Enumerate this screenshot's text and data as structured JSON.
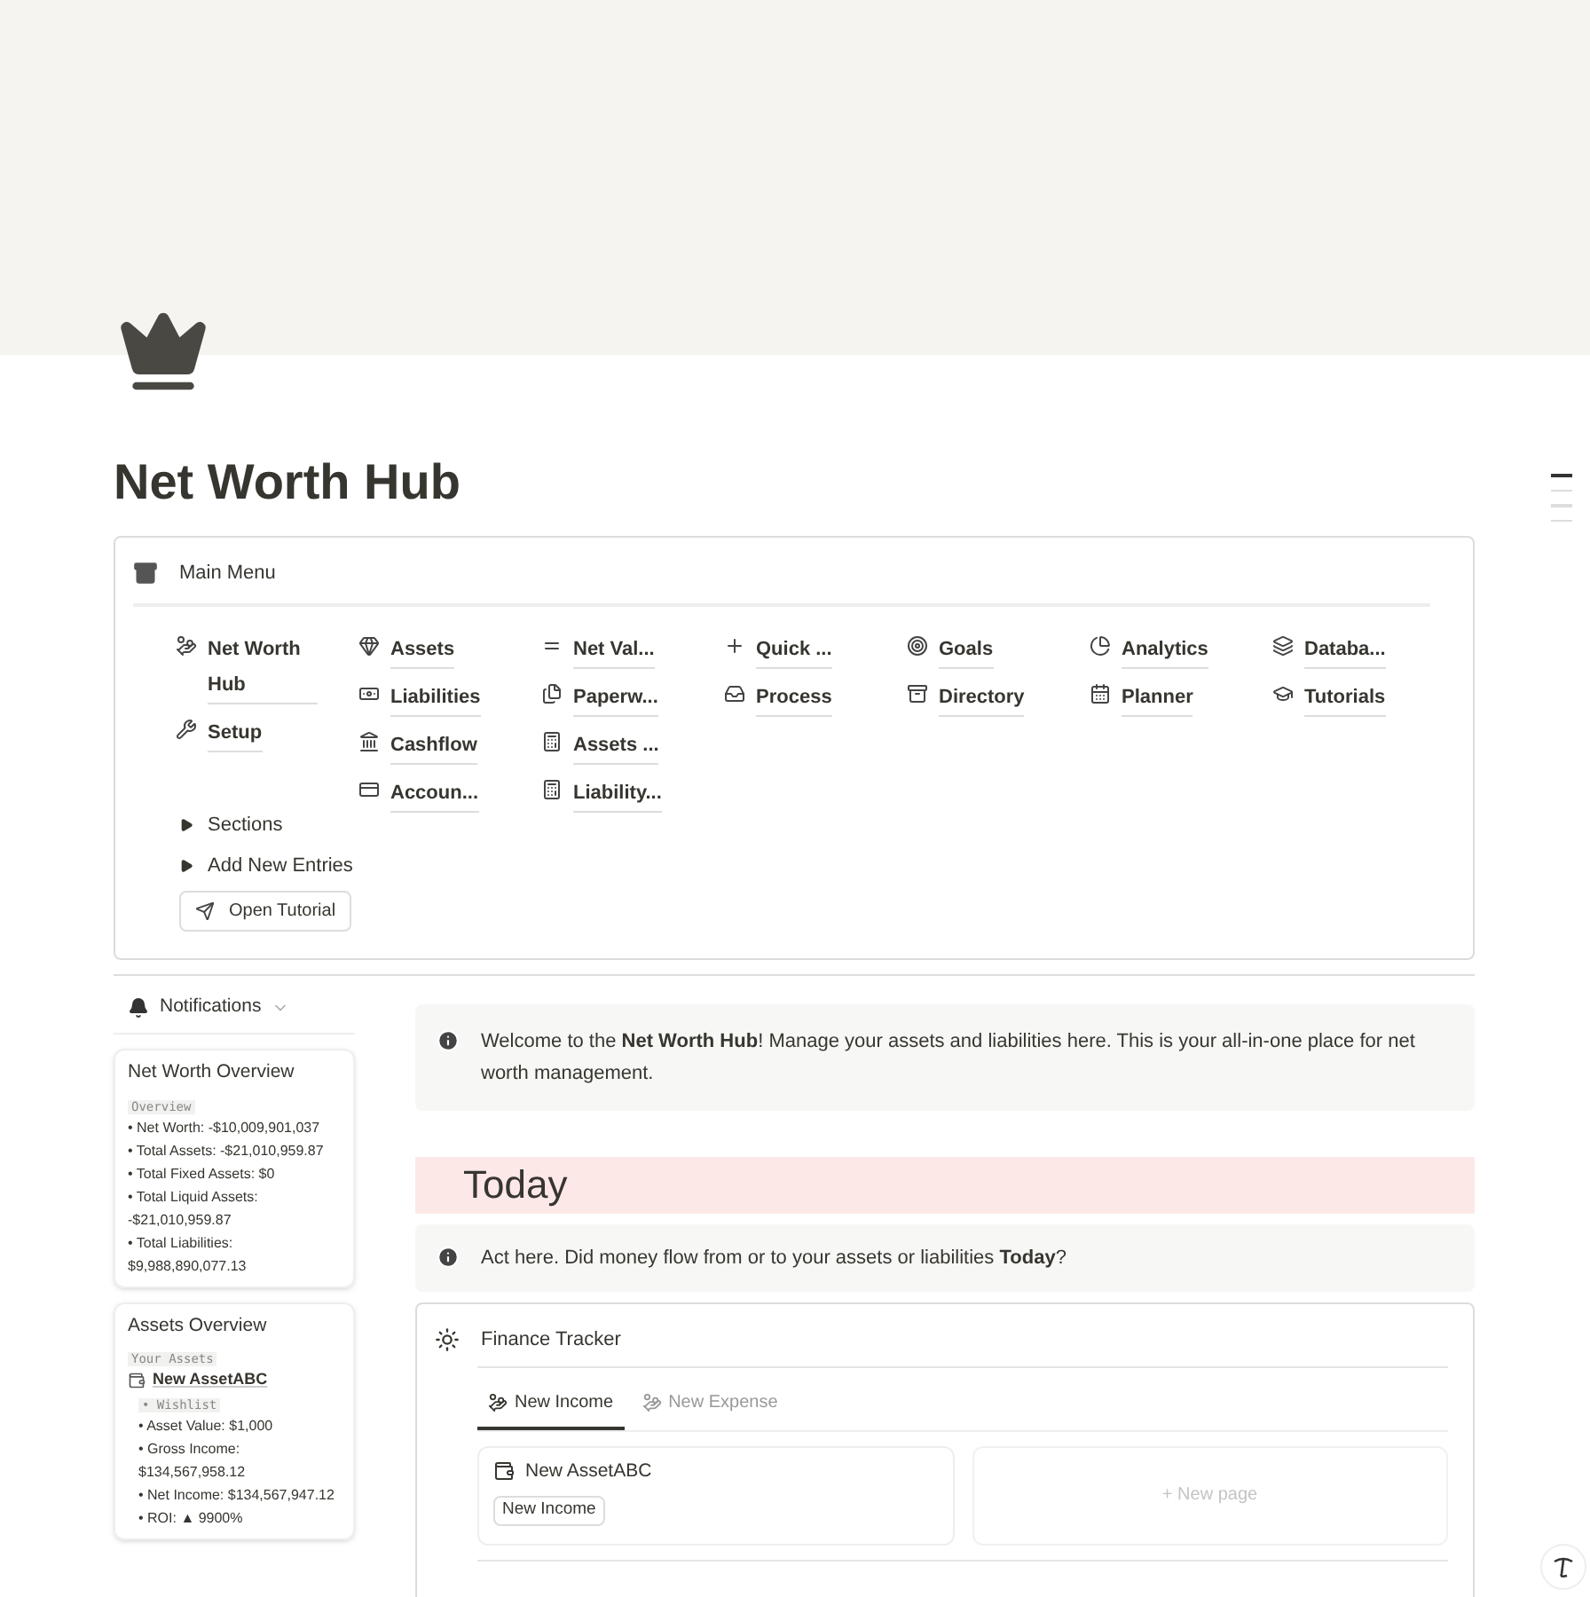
{
  "page": {
    "title": "Net Worth Hub"
  },
  "main_menu": {
    "title": "Main Menu",
    "columns": [
      {
        "items": [
          {
            "label": "Net Worth Hub"
          },
          {
            "label": "Setup"
          }
        ]
      },
      {
        "items": [
          {
            "label": "Assets"
          },
          {
            "label": "Liabilities"
          },
          {
            "label": "Cashflow"
          },
          {
            "label": "Accoun..."
          }
        ]
      },
      {
        "items": [
          {
            "label": "Net Val..."
          },
          {
            "label": "Paperw..."
          },
          {
            "label": "Assets ..."
          },
          {
            "label": "Liability..."
          }
        ]
      },
      {
        "items": [
          {
            "label": "Quick ..."
          },
          {
            "label": "Process"
          }
        ]
      },
      {
        "items": [
          {
            "label": "Goals"
          },
          {
            "label": "Directory"
          }
        ]
      },
      {
        "items": [
          {
            "label": "Analytics"
          },
          {
            "label": "Planner"
          }
        ]
      },
      {
        "items": [
          {
            "label": "Databa..."
          },
          {
            "label": "Tutorials"
          }
        ]
      }
    ],
    "toggles": [
      {
        "label": "Sections",
        "expanded": false
      },
      {
        "label": "Add New Entries",
        "expanded": false
      }
    ],
    "button": "Open Tutorial"
  },
  "sidebar": {
    "notifications": "Notifications",
    "cards": [
      {
        "title": "Net Worth Overview",
        "lines": [
          {
            "kind": "code",
            "text": "Overview"
          },
          {
            "kind": "bullet",
            "text": "• Net Worth: -$10,009,901,037"
          },
          {
            "kind": "bullet",
            "text": "• Total Assets: -$21,010,959.87"
          },
          {
            "kind": "bullet",
            "text": "• Total Fixed Assets: $0"
          },
          {
            "kind": "bullet",
            "text": "• Total Liquid Assets: -$21,010,959.87"
          },
          {
            "kind": "bullet",
            "text": "• Total Liabilities: $9,988,890,077.13"
          }
        ]
      },
      {
        "title": "Assets Overview",
        "lines": [
          {
            "kind": "code",
            "text": "Your Assets"
          },
          {
            "kind": "link",
            "text": "New AssetABC"
          },
          {
            "kind": "code_sub",
            "text": "• Wishlist"
          },
          {
            "kind": "sub",
            "text": "• Asset Value: $1,000"
          },
          {
            "kind": "sub",
            "text": "• Gross Income: $134,567,958.12"
          },
          {
            "kind": "sub",
            "text": "• Net Income: $134,567,947.12"
          },
          {
            "kind": "sub",
            "text": "• ROI: ▲ 9900%"
          }
        ]
      }
    ]
  },
  "welcome": "Welcome to the **Net Worth Hub**! Manage your assets and liabilities here. This is your all-in-one place for net worth management.",
  "today": {
    "heading": "Today",
    "note": "Act here. Did money flow from or to your assets or liabilities **Today**?"
  },
  "finance_tracker": {
    "title": "Finance Tracker",
    "tabs": [
      {
        "label": "New Income",
        "selected": true
      },
      {
        "label": "New Expense",
        "selected": false
      }
    ],
    "card": {
      "title": "New AssetABC",
      "tag": "New Income"
    },
    "new_page": "+ New page"
  },
  "toc": [
    {
      "selected": true
    },
    {
      "selected": false
    },
    {
      "selected": false
    },
    {
      "selected": false
    }
  ]
}
